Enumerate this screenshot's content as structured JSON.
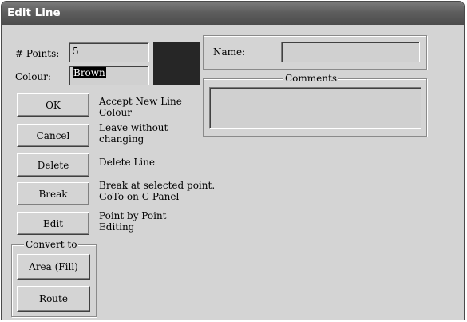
{
  "window": {
    "title": "Edit Line"
  },
  "points": {
    "label": "# Points:",
    "value": "5"
  },
  "colour": {
    "label": "Colour:",
    "value": "Brown",
    "swatch_color": "#262626"
  },
  "name": {
    "label": "Name:",
    "value": ""
  },
  "comments": {
    "label": "Comments",
    "value": ""
  },
  "actions": [
    {
      "label": "OK",
      "desc_line1": "Accept New Line",
      "desc_line2": "Colour"
    },
    {
      "label": "Cancel",
      "desc_line1": "Leave without",
      "desc_line2": "changing"
    },
    {
      "label": "Delete",
      "desc_line1": "Delete Line",
      "desc_line2": ""
    },
    {
      "label": "Break",
      "desc_line1": "Break at selected point.",
      "desc_line2": "GoTo on C-Panel"
    },
    {
      "label": "Edit",
      "desc_line1": "Point by Point",
      "desc_line2": "Editing"
    }
  ],
  "convert": {
    "label": "Convert to",
    "buttons": [
      {
        "label": "Area (Fill)"
      },
      {
        "label": "Route"
      }
    ]
  }
}
